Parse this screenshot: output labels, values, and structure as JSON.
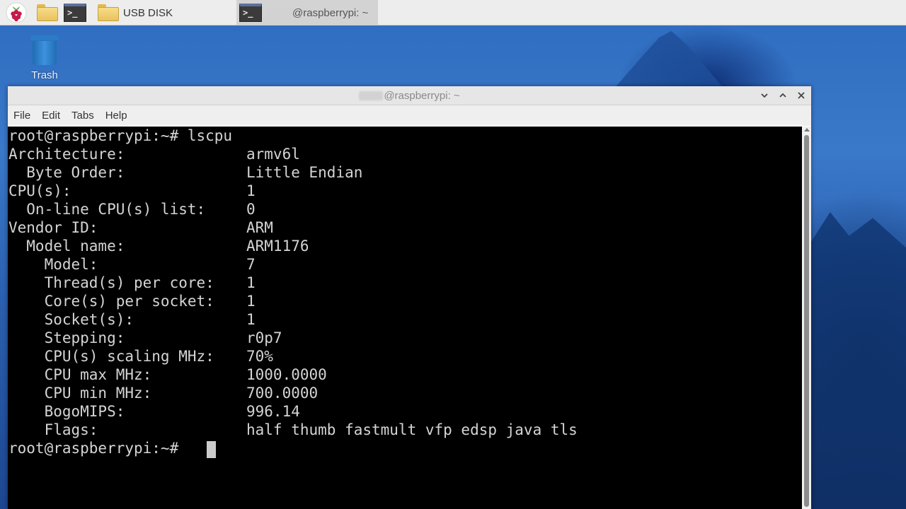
{
  "taskbar": {
    "usb_label": "USB DISK",
    "active_task_label": "@raspberrypi: ~"
  },
  "desktop": {
    "trash_label": "Trash"
  },
  "window": {
    "title": "@raspberrypi: ~",
    "menu": [
      "File",
      "Edit",
      "Tabs",
      "Help"
    ]
  },
  "terminal": {
    "prompt_cmd": "root@raspberrypi:~# lscpu",
    "rows": [
      {
        "key": "Architecture:",
        "value": "armv6l"
      },
      {
        "key": "  Byte Order:",
        "value": "Little Endian"
      },
      {
        "key": "CPU(s):",
        "value": "1"
      },
      {
        "key": "  On-line CPU(s) list:",
        "value": "0"
      },
      {
        "key": "Vendor ID:",
        "value": "ARM"
      },
      {
        "key": "  Model name:",
        "value": "ARM1176"
      },
      {
        "key": "    Model:",
        "value": "7"
      },
      {
        "key": "    Thread(s) per core:",
        "value": "1"
      },
      {
        "key": "    Core(s) per socket:",
        "value": "1"
      },
      {
        "key": "    Socket(s):",
        "value": "1"
      },
      {
        "key": "    Stepping:",
        "value": "r0p7"
      },
      {
        "key": "    CPU(s) scaling MHz:",
        "value": "70%"
      },
      {
        "key": "    CPU max MHz:",
        "value": "1000.0000"
      },
      {
        "key": "    CPU min MHz:",
        "value": "700.0000"
      },
      {
        "key": "    BogoMIPS:",
        "value": "996.14"
      },
      {
        "key": "    Flags:",
        "value": "half thumb fastmult vfp edsp java tls"
      }
    ],
    "prompt_end": "root@raspberrypi:~# "
  }
}
